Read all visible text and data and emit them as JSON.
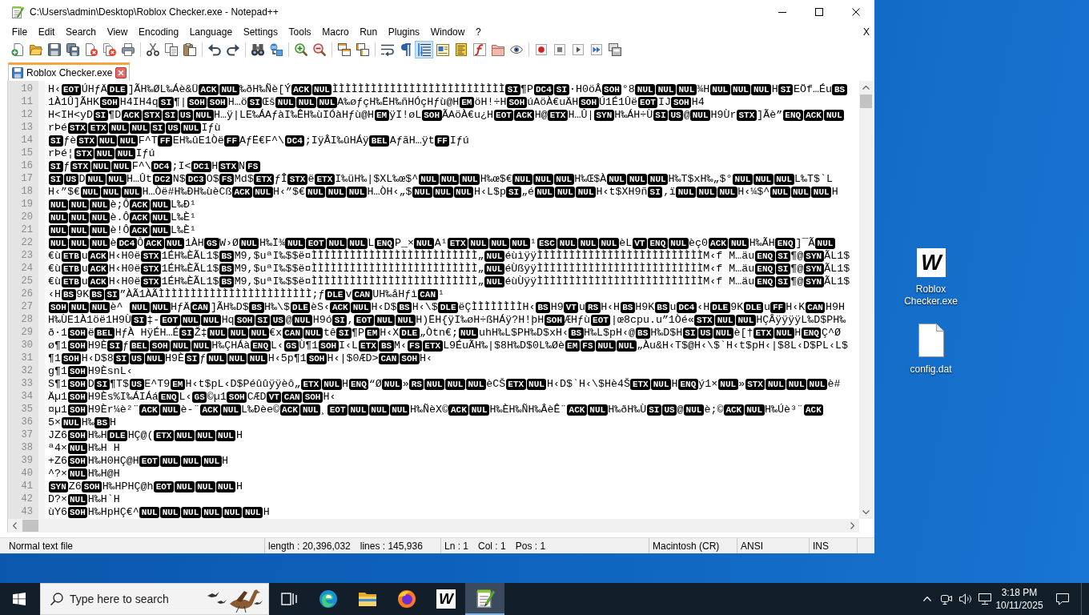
{
  "window": {
    "title": "C:\\Users\\admin\\Desktop\\Roblox Checker.exe - Notepad++"
  },
  "menu": {
    "items": [
      "File",
      "Edit",
      "Search",
      "View",
      "Encoding",
      "Language",
      "Settings",
      "Tools",
      "Macro",
      "Run",
      "Plugins",
      "Window",
      "?"
    ],
    "close_label": "X"
  },
  "toolbar": {
    "groups": [
      {
        "buttons": [
          {
            "kind": "new",
            "on": false
          },
          {
            "kind": "open",
            "on": false
          },
          {
            "kind": "save",
            "on": false
          },
          {
            "kind": "save-all",
            "on": false
          },
          {
            "kind": "close",
            "on": false
          },
          {
            "kind": "close-all",
            "on": false
          },
          {
            "kind": "print",
            "on": false
          }
        ]
      },
      {
        "buttons": [
          {
            "kind": "cut",
            "on": false
          },
          {
            "kind": "copy",
            "on": false
          },
          {
            "kind": "paste",
            "on": false
          }
        ]
      },
      {
        "buttons": [
          {
            "kind": "undo",
            "on": false
          },
          {
            "kind": "redo",
            "on": false
          }
        ]
      },
      {
        "buttons": [
          {
            "kind": "find",
            "on": false
          },
          {
            "kind": "replace",
            "on": false
          }
        ]
      },
      {
        "buttons": [
          {
            "kind": "zoom-in",
            "on": false
          },
          {
            "kind": "zoom-out",
            "on": false
          }
        ]
      },
      {
        "buttons": [
          {
            "kind": "sync-vertical",
            "on": false
          },
          {
            "kind": "sync-horizontal",
            "on": false
          }
        ]
      },
      {
        "buttons": [
          {
            "kind": "word-wrap",
            "on": false
          },
          {
            "kind": "all-chars",
            "on": false
          },
          {
            "kind": "indent-guide",
            "on": true
          },
          {
            "kind": "udl",
            "on": false
          },
          {
            "kind": "document-map",
            "on": false
          },
          {
            "kind": "function-list",
            "on": false
          },
          {
            "kind": "folder-workspace",
            "on": false
          },
          {
            "kind": "monitoring",
            "on": false
          }
        ]
      },
      {
        "buttons": [
          {
            "kind": "record",
            "on": false
          },
          {
            "kind": "stop",
            "on": false
          },
          {
            "kind": "play",
            "on": false
          },
          {
            "kind": "play-multiple",
            "on": false
          },
          {
            "kind": "save-macro",
            "on": false
          }
        ]
      }
    ]
  },
  "tabs": [
    {
      "label": "Roblox Checker.exe",
      "selected": true
    }
  ],
  "editor": {
    "lines": [
      {
        "number": "10",
        "segments": [
          {
            "text": "H‹"
          },
          {
            "control": "EOT"
          },
          {
            "text": "ÚHƒÄ"
          },
          {
            "control": "DLE"
          },
          {
            "text": "]ÃH‰ØL‰Áè&Ü"
          },
          {
            "control": "ACK"
          },
          {
            "control": "NUL"
          },
          {
            "text": "‰ðH‰Ñè[Ý"
          },
          {
            "control": "ACK"
          },
          {
            "control": "NUL"
          },
          {
            "text": "ÌÌÌÌÌÌÌÌÌÌÌÌÌÌÌÌÌÌÌÌÌÌÌÌÌÌÌ"
          },
          {
            "control": "SI"
          },
          {
            "text": "¶P"
          },
          {
            "control": "DC4"
          },
          {
            "control": "SI"
          },
          {
            "text": "·H0öÂ"
          },
          {
            "control": "SOH"
          },
          {
            "text": "°8"
          },
          {
            "control": "NUL"
          },
          {
            "control": "NUL"
          },
          {
            "control": "NUL"
          },
          {
            "text": "¾H"
          },
          {
            "control": "NUL"
          },
          {
            "control": "NUL"
          },
          {
            "control": "NUL"
          },
          {
            "text": "H"
          },
          {
            "control": "SI"
          },
          {
            "text": "EÖf…Éu"
          },
          {
            "control": "BS"
          }
        ]
      },
      {
        "number": "11",
        "segments": [
          {
            "text": "1À1Û]ÃHK"
          },
          {
            "control": "SOH"
          },
          {
            "text": "H4IH4q"
          },
          {
            "control": "SI"
          },
          {
            "text": "¶|"
          },
          {
            "control": "SOH"
          },
          {
            "control": "SOH"
          },
          {
            "text": "H…ö"
          },
          {
            "control": "SI"
          },
          {
            "text": "Œš"
          },
          {
            "control": "NUL"
          },
          {
            "control": "NUL"
          },
          {
            "control": "NUL"
          },
          {
            "text": "A‰øƒçH‰ËH‰ñHÓçHƒù@H"
          },
          {
            "control": "EM"
          },
          {
            "text": "öH!÷H"
          },
          {
            "control": "SOH"
          },
          {
            "text": "úAöÀ€uÄH"
          },
          {
            "control": "SOH"
          },
          {
            "text": "Ú1É1Ûë"
          },
          {
            "control": "EOT"
          },
          {
            "text": "IJ"
          },
          {
            "control": "SOH"
          },
          {
            "text": "H4"
          }
        ]
      },
      {
        "number": "12",
        "segments": [
          {
            "text": "H<IH<yD"
          },
          {
            "control": "SI"
          },
          {
            "text": "¶D"
          },
          {
            "control": "ACK"
          },
          {
            "control": "STX"
          },
          {
            "control": "SI"
          },
          {
            "control": "US"
          },
          {
            "control": "NUL"
          },
          {
            "text": "H…ÿ|LE‰ÁAƒàI‰ÊH‰ùIÓàHƒù@H"
          },
          {
            "control": "EM"
          },
          {
            "text": "ÿI!øL"
          },
          {
            "control": "SOH"
          },
          {
            "text": "ÃAöÀ€u¿H"
          },
          {
            "control": "EOT"
          },
          {
            "control": "ACK"
          },
          {
            "text": "H@"
          },
          {
            "control": "ETX"
          },
          {
            "text": "H…Û|"
          },
          {
            "control": "SYN"
          },
          {
            "text": "H‰ÁH÷Ù"
          },
          {
            "control": "SI"
          },
          {
            "control": "US"
          },
          {
            "text": "@"
          },
          {
            "control": "NUL"
          },
          {
            "text": "H9Ùr"
          },
          {
            "control": "STX"
          },
          {
            "text": "]Ãè”"
          },
          {
            "control": "ENQ"
          },
          {
            "control": "ACK"
          },
          {
            "control": "NUL"
          }
        ]
      },
      {
        "number": "13",
        "segments": [
          {
            "text": "rÞé"
          },
          {
            "control": "STX"
          },
          {
            "control": "ETX"
          },
          {
            "control": "NUL"
          },
          {
            "control": "NUL"
          },
          {
            "control": "SI"
          },
          {
            "control": "US"
          },
          {
            "control": "NUL"
          },
          {
            "text": "Iƒù"
          }
        ]
      },
      {
        "number": "14",
        "segments": [
          {
            "control": "SI"
          },
          {
            "text": "ƒè"
          },
          {
            "control": "STX"
          },
          {
            "control": "NUL"
          },
          {
            "control": "NUL"
          },
          {
            "text": "F^T"
          },
          {
            "control": "FF"
          },
          {
            "text": "EH‰ûE1Òë"
          },
          {
            "control": "FF"
          },
          {
            "text": "AƒË€F^\\"
          },
          {
            "control": "DC4"
          },
          {
            "text": ";IÿÂI‰ûHÁÿ"
          },
          {
            "control": "BEL"
          },
          {
            "text": "AƒãH…ÿt"
          },
          {
            "control": "FF"
          },
          {
            "text": "Iƒú"
          }
        ]
      },
      {
        "number": "15",
        "segments": [
          {
            "text": "rÞé¦"
          },
          {
            "control": "STX"
          },
          {
            "control": "NUL"
          },
          {
            "control": "NUL"
          },
          {
            "text": "Iƒú"
          }
        ]
      },
      {
        "number": "16",
        "segments": [
          {
            "control": "SI"
          },
          {
            "text": "ƒ"
          },
          {
            "control": "STX"
          },
          {
            "control": "NUL"
          },
          {
            "control": "NUL"
          },
          {
            "text": "F^\\"
          },
          {
            "control": "DC4"
          },
          {
            "text": ";I<"
          },
          {
            "control": "DC1"
          },
          {
            "text": "H"
          },
          {
            "control": "STX"
          },
          {
            "text": "N"
          },
          {
            "control": "FS"
          }
        ]
      },
      {
        "number": "17",
        "segments": [
          {
            "control": "SI"
          },
          {
            "control": "US"
          },
          {
            "text": "D"
          },
          {
            "control": "NUL"
          },
          {
            "control": "NUL"
          },
          {
            "text": "H…Ût"
          },
          {
            "control": "DC2"
          },
          {
            "text": "N$"
          },
          {
            "control": "DC3"
          },
          {
            "text": "O$"
          },
          {
            "control": "FS"
          },
          {
            "text": "Md$"
          },
          {
            "control": "ETX"
          },
          {
            "text": "ƒÎ"
          },
          {
            "control": "STX"
          },
          {
            "text": "ë"
          },
          {
            "control": "ETX"
          },
          {
            "text": "I‰üH‰|$XL‰œ$^"
          },
          {
            "control": "NUL"
          },
          {
            "control": "NUL"
          },
          {
            "control": "NUL"
          },
          {
            "text": "H‰œ$€"
          },
          {
            "control": "NUL"
          },
          {
            "control": "NUL"
          },
          {
            "control": "NUL"
          },
          {
            "text": "H‰Œ$À"
          },
          {
            "control": "NUL"
          },
          {
            "control": "NUL"
          },
          {
            "control": "NUL"
          },
          {
            "text": "H‰T$xH‰„$°"
          },
          {
            "control": "NUL"
          },
          {
            "control": "NUL"
          },
          {
            "control": "NUL"
          },
          {
            "text": "L‰T$`L"
          }
        ]
      },
      {
        "number": "18",
        "segments": [
          {
            "text": "H‹”$€"
          },
          {
            "control": "NUL"
          },
          {
            "control": "NUL"
          },
          {
            "control": "NUL"
          },
          {
            "text": "H…Òë#H‰ÐH‰ùèCß"
          },
          {
            "control": "ACK"
          },
          {
            "control": "NUL"
          },
          {
            "text": "H‹”$€"
          },
          {
            "control": "NUL"
          },
          {
            "control": "NUL"
          },
          {
            "control": "NUL"
          },
          {
            "text": "H…ÒH‹„$"
          },
          {
            "control": "NUL"
          },
          {
            "control": "NUL"
          },
          {
            "control": "NUL"
          },
          {
            "text": "H‹L$p"
          },
          {
            "control": "SI"
          },
          {
            "text": "„é"
          },
          {
            "control": "NUL"
          },
          {
            "control": "NUL"
          },
          {
            "control": "NUL"
          },
          {
            "text": "H‹t$XH9ñ"
          },
          {
            "control": "SI"
          },
          {
            "text": "‚ï"
          },
          {
            "control": "NUL"
          },
          {
            "control": "NUL"
          },
          {
            "control": "NUL"
          },
          {
            "text": "H‹¼$^"
          },
          {
            "control": "NUL"
          },
          {
            "control": "NUL"
          },
          {
            "control": "NUL"
          },
          {
            "text": "H"
          }
        ]
      },
      {
        "number": "19",
        "segments": [
          {
            "control": "NUL"
          },
          {
            "control": "NUL"
          },
          {
            "control": "NUL"
          },
          {
            "text": "è;Ô"
          },
          {
            "control": "ACK"
          },
          {
            "control": "NUL"
          },
          {
            "text": "L‰Ð¹"
          }
        ]
      },
      {
        "number": "20",
        "segments": [
          {
            "control": "NUL"
          },
          {
            "control": "NUL"
          },
          {
            "control": "NUL"
          },
          {
            "text": "è.Ô"
          },
          {
            "control": "ACK"
          },
          {
            "control": "NUL"
          },
          {
            "text": "L‰È¹"
          }
        ]
      },
      {
        "number": "21",
        "segments": [
          {
            "control": "NUL"
          },
          {
            "control": "NUL"
          },
          {
            "control": "NUL"
          },
          {
            "text": "è!Ô"
          },
          {
            "control": "ACK"
          },
          {
            "control": "NUL"
          },
          {
            "text": "L‰È¹"
          }
        ]
      },
      {
        "number": "22",
        "segments": [
          {
            "control": "NUL"
          },
          {
            "control": "NUL"
          },
          {
            "control": "NUL"
          },
          {
            "text": "è"
          },
          {
            "control": "DC4"
          },
          {
            "text": "Ô"
          },
          {
            "control": "ACK"
          },
          {
            "control": "NUL"
          },
          {
            "text": "1ÀH"
          },
          {
            "control": "GS"
          },
          {
            "text": "W›Ø"
          },
          {
            "control": "NUL"
          },
          {
            "text": "H‰Ï¾"
          },
          {
            "control": "NUL"
          },
          {
            "control": "EOT"
          },
          {
            "control": "NUL"
          },
          {
            "control": "NUL"
          },
          {
            "text": "L"
          },
          {
            "control": "ENQ"
          },
          {
            "text": "P_×"
          },
          {
            "control": "NUL"
          },
          {
            "text": "A¹"
          },
          {
            "control": "ETX"
          },
          {
            "control": "NUL"
          },
          {
            "control": "NUL"
          },
          {
            "control": "NUL"
          },
          {
            "text": "¹"
          },
          {
            "control": "ESC"
          },
          {
            "control": "NUL"
          },
          {
            "control": "NUL"
          },
          {
            "control": "NUL"
          },
          {
            "text": "èL"
          },
          {
            "control": "VT"
          },
          {
            "control": "ENQ"
          },
          {
            "control": "NUL"
          },
          {
            "text": "èç0"
          },
          {
            "control": "ACK"
          },
          {
            "control": "NUL"
          },
          {
            "text": "H‰ÃH"
          },
          {
            "control": "ENQ"
          },
          {
            "text": "]¯Ã"
          },
          {
            "control": "NUL"
          }
        ]
      },
      {
        "number": "23",
        "segments": [
          {
            "text": "€ù"
          },
          {
            "control": "ETB"
          },
          {
            "text": "u"
          },
          {
            "control": "ACK"
          },
          {
            "text": "H‹H0ë"
          },
          {
            "control": "STX"
          },
          {
            "text": "1ÉH‰ÈÃL1$"
          },
          {
            "control": "BS"
          },
          {
            "text": "M9,$uªI‰$$ë¤ÌÌÌÌÌÌÌÌÌÌÌÌÌÌÌÌÌÌÌÌÌÌÌÌÌÌ„"
          },
          {
            "control": "NUL"
          },
          {
            "text": "éùìÿÿÌÌÌÌÌÌÌÌÌÌÌÌÌÌÌÌÌÌÌÌÌÌÌÌÌÌM‹f M…äu"
          },
          {
            "control": "ENQ"
          },
          {
            "control": "SI"
          },
          {
            "text": "¶@"
          },
          {
            "control": "SYN"
          },
          {
            "text": "ÃL1$"
          }
        ]
      },
      {
        "number": "24",
        "segments": [
          {
            "text": "€ù"
          },
          {
            "control": "ETB"
          },
          {
            "text": "u"
          },
          {
            "control": "ACK"
          },
          {
            "text": "H‹H0ë"
          },
          {
            "control": "STX"
          },
          {
            "text": "1ÉH‰ÈÃL1$"
          },
          {
            "control": "BS"
          },
          {
            "text": "M9,$uªI‰$$ë¤ÌÌÌÌÌÌÌÌÌÌÌÌÌÌÌÌÌÌÌÌÌÌÌÌÌÌ„"
          },
          {
            "control": "NUL"
          },
          {
            "text": "éÙßÿÿÌÌÌÌÌÌÌÌÌÌÌÌÌÌÌÌÌÌÌÌÌÌÌÌÌÌM‹f M…äu"
          },
          {
            "control": "ENQ"
          },
          {
            "control": "SI"
          },
          {
            "text": "¶@"
          },
          {
            "control": "SYN"
          },
          {
            "text": "ÃL1$"
          }
        ]
      },
      {
        "number": "25",
        "segments": [
          {
            "text": "€ù"
          },
          {
            "control": "ETB"
          },
          {
            "text": "u"
          },
          {
            "control": "ACK"
          },
          {
            "text": "H‹H0ë"
          },
          {
            "control": "STX"
          },
          {
            "text": "1ÉH‰ÈÃL1$"
          },
          {
            "control": "BS"
          },
          {
            "text": "M9,$uªI‰$$ë¤ÌÌÌÌÌÌÌÌÌÌÌÌÌÌÌÌÌÌÌÌÌÌÌÌÌÌ„"
          },
          {
            "control": "NUL"
          },
          {
            "text": "éùÙÿÿÌÌÌÌÌÌÌÌÌÌÌÌÌÌÌÌÌÌÌÌÌÌÌÌÌÌM‹f M…äu"
          },
          {
            "control": "ENQ"
          },
          {
            "control": "SI"
          },
          {
            "text": "¶@"
          },
          {
            "control": "SYN"
          },
          {
            "text": "ÃL1$"
          }
        ]
      },
      {
        "number": "26",
        "segments": [
          {
            "text": "‹H"
          },
          {
            "control": "BS"
          },
          {
            "text": "9K"
          },
          {
            "control": "BS"
          },
          {
            "control": "SI"
          },
          {
            "text": "”ÀÃ1ÀÃÌÌÌÌÌÌÌÌÌÌÌÌÌÌÌÌÌÌÌÌÌÌÌÌ;ƒ"
          },
          {
            "control": "DLE"
          },
          {
            "text": "v"
          },
          {
            "control": "CAN"
          },
          {
            "text": "UH‰åHƒì"
          },
          {
            "control": "CAN"
          },
          {
            "text": "¹"
          }
        ]
      },
      {
        "number": "27",
        "segments": [
          {
            "control": "SOH"
          },
          {
            "control": "NUL"
          },
          {
            "control": "NUL"
          },
          {
            "text": "è^ "
          },
          {
            "control": "NUL"
          },
          {
            "control": "NUL"
          },
          {
            "text": "HƒÄ"
          },
          {
            "control": "CAN"
          },
          {
            "text": "]ÃH‰D$"
          },
          {
            "control": "BS"
          },
          {
            "text": "H‰\\$"
          },
          {
            "control": "DLE"
          },
          {
            "text": "èS‹"
          },
          {
            "control": "ACK"
          },
          {
            "control": "NUL"
          },
          {
            "text": "H‹D$"
          },
          {
            "control": "BS"
          },
          {
            "text": "H‹\\$"
          },
          {
            "control": "DLE"
          },
          {
            "text": "ëÇÌÌÌÌÌÌÌÌH‹"
          },
          {
            "control": "BS"
          },
          {
            "text": "H9"
          },
          {
            "control": "VT"
          },
          {
            "text": "u"
          },
          {
            "control": "RS"
          },
          {
            "text": "H‹H"
          },
          {
            "control": "BS"
          },
          {
            "text": "H9K"
          },
          {
            "control": "BS"
          },
          {
            "text": "u"
          },
          {
            "control": "DC4"
          },
          {
            "text": "‹H"
          },
          {
            "control": "DLE"
          },
          {
            "text": "9K"
          },
          {
            "control": "DLE"
          },
          {
            "text": "u"
          },
          {
            "control": "FF"
          },
          {
            "text": "H‹K"
          },
          {
            "control": "CAN"
          },
          {
            "text": "H9H"
          }
        ]
      },
      {
        "number": "28",
        "segments": [
          {
            "text": "H‰ÙE1À1öë1H9Ù"
          },
          {
            "control": "SI"
          },
          {
            "text": "‡-"
          },
          {
            "control": "EOT"
          },
          {
            "control": "NUL"
          },
          {
            "control": "NUL"
          },
          {
            "text": "Hq"
          },
          {
            "control": "SOH"
          },
          {
            "control": "SI"
          },
          {
            "control": "US"
          },
          {
            "text": "@"
          },
          {
            "control": "NUL"
          },
          {
            "text": "H9ó"
          },
          {
            "control": "SI"
          },
          {
            "text": ","
          },
          {
            "control": "EOT"
          },
          {
            "control": "NUL"
          },
          {
            "control": "NUL"
          },
          {
            "text": "H)ËH{ÿI‰øH÷ßHÁÿ?H!þH"
          },
          {
            "control": "SOH"
          },
          {
            "text": "ÆHƒù"
          },
          {
            "control": "EOT"
          },
          {
            "text": "|œ8cpu.u”1Òé«"
          },
          {
            "control": "STX"
          },
          {
            "control": "NUL"
          },
          {
            "control": "NUL"
          },
          {
            "text": "HÇÂÿÿÿÿL‰D$PH‰"
          }
        ]
      },
      {
        "number": "29",
        "segments": [
          {
            "text": "ð·1"
          },
          {
            "control": "SOH"
          },
          {
            "text": "ë"
          },
          {
            "control": "BEL"
          },
          {
            "text": "HƒÀ HÿÉH…É"
          },
          {
            "control": "SI"
          },
          {
            "text": "Ž‡"
          },
          {
            "control": "NUL"
          },
          {
            "control": "NUL"
          },
          {
            "control": "NUL"
          },
          {
            "text": "€x"
          },
          {
            "control": "CAN"
          },
          {
            "control": "NUL"
          },
          {
            "text": "tê"
          },
          {
            "control": "SI"
          },
          {
            "text": "¶P"
          },
          {
            "control": "EM"
          },
          {
            "text": "H‹X"
          },
          {
            "control": "DLE"
          },
          {
            "text": "„Òtn€;"
          },
          {
            "control": "NUL"
          },
          {
            "text": "uhH‰L$PH‰D$xH‹"
          },
          {
            "control": "BS"
          },
          {
            "text": "H‰L$pH‹@"
          },
          {
            "control": "BS"
          },
          {
            "text": "H‰D$H"
          },
          {
            "control": "SI"
          },
          {
            "control": "US"
          },
          {
            "control": "NUL"
          },
          {
            "text": "è[†"
          },
          {
            "control": "ETX"
          },
          {
            "control": "NUL"
          },
          {
            "text": "H"
          },
          {
            "control": "ENQ"
          },
          {
            "text": "Ç^Ø"
          }
        ]
      },
      {
        "number": "30",
        "segments": [
          {
            "text": "ø¶1"
          },
          {
            "control": "SOH"
          },
          {
            "text": "H9È"
          },
          {
            "control": "SI"
          },
          {
            "text": "ƒ"
          },
          {
            "control": "BEL"
          },
          {
            "control": "SOH"
          },
          {
            "control": "NUL"
          },
          {
            "control": "NUL"
          },
          {
            "text": "H‰ÇHÁà"
          },
          {
            "control": "ENQ"
          },
          {
            "text": "L‹"
          },
          {
            "control": "GS"
          },
          {
            "text": "Ù¶1"
          },
          {
            "control": "SOH"
          },
          {
            "text": "I‹L"
          },
          {
            "control": "ETX"
          },
          {
            "control": "BS"
          },
          {
            "text": "M‹"
          },
          {
            "control": "FS"
          },
          {
            "control": "ETX"
          },
          {
            "text": "L9ÉuÃH‰|$8H‰D$0L‰Øè"
          },
          {
            "control": "EM"
          },
          {
            "control": "FS"
          },
          {
            "control": "NUL"
          },
          {
            "control": "NUL"
          },
          {
            "text": "„Àu&H‹T$@H‹\\$`H‹t$pH‹|$8L‹D$PL‹L$"
          }
        ]
      },
      {
        "number": "31",
        "segments": [
          {
            "text": "¶1"
          },
          {
            "control": "SOH"
          },
          {
            "text": "H‹D$8"
          },
          {
            "control": "SI"
          },
          {
            "control": "US"
          },
          {
            "control": "NUL"
          },
          {
            "text": "H9È"
          },
          {
            "control": "SI"
          },
          {
            "text": "ƒ"
          },
          {
            "control": "NUL"
          },
          {
            "control": "NUL"
          },
          {
            "control": "NUL"
          },
          {
            "text": "H‹5p¶1"
          },
          {
            "control": "SOH"
          },
          {
            "text": "H‹|$0ÆD>"
          },
          {
            "control": "CAN"
          },
          {
            "control": "SOH"
          },
          {
            "text": "H‹"
          }
        ]
      },
      {
        "number": "32",
        "segments": [
          {
            "text": "g¶1"
          },
          {
            "control": "SOH"
          },
          {
            "text": "H9ÈsnL‹"
          }
        ]
      },
      {
        "number": "33",
        "segments": [
          {
            "text": "S¶1"
          },
          {
            "control": "SOH"
          },
          {
            "text": "D"
          },
          {
            "control": "SI"
          },
          {
            "text": "¶T$"
          },
          {
            "control": "US"
          },
          {
            "text": "E^T9"
          },
          {
            "control": "EM"
          },
          {
            "text": "H‹t$pL‹D$Péûûÿÿèô„"
          },
          {
            "control": "ETX"
          },
          {
            "control": "NUL"
          },
          {
            "text": "H"
          },
          {
            "control": "ENQ"
          },
          {
            "text": "“Ø"
          },
          {
            "control": "NUL"
          },
          {
            "text": "»"
          },
          {
            "control": "RS"
          },
          {
            "control": "NUL"
          },
          {
            "control": "NUL"
          },
          {
            "control": "NUL"
          },
          {
            "text": "èCŠ"
          },
          {
            "control": "ETX"
          },
          {
            "control": "NUL"
          },
          {
            "text": "H‹D$`H‹\\$Hè4Š"
          },
          {
            "control": "ETX"
          },
          {
            "control": "NUL"
          },
          {
            "text": "H"
          },
          {
            "control": "ENQ"
          },
          {
            "text": "ý1×"
          },
          {
            "control": "NUL"
          },
          {
            "text": "»"
          },
          {
            "control": "STX"
          },
          {
            "control": "NUL"
          },
          {
            "control": "NUL"
          },
          {
            "control": "NUL"
          },
          {
            "text": "è#"
          }
        ]
      },
      {
        "number": "34",
        "segments": [
          {
            "text": "Äµ1"
          },
          {
            "control": "SOH"
          },
          {
            "text": "H9Ès%I‰ÁIÁá"
          },
          {
            "control": "ENQ"
          },
          {
            "text": "L‹"
          },
          {
            "control": "GS"
          },
          {
            "text": "©µ1"
          },
          {
            "control": "SOH"
          },
          {
            "text": "CÆD"
          },
          {
            "control": "VT"
          },
          {
            "control": "CAN"
          },
          {
            "control": "SOH"
          },
          {
            "text": "H‹"
          }
        ]
      },
      {
        "number": "35",
        "segments": [
          {
            "text": "¤µ1"
          },
          {
            "control": "SOH"
          },
          {
            "text": "H9Èr¼è²¨"
          },
          {
            "control": "ACK"
          },
          {
            "control": "NUL"
          },
          {
            "text": "è-¨"
          },
          {
            "control": "ACK"
          },
          {
            "control": "NUL"
          },
          {
            "text": "L‰Ðèe©"
          },
          {
            "control": "ACK"
          },
          {
            "control": "NUL"
          },
          {
            "text": "¸"
          },
          {
            "control": "EOT"
          },
          {
            "control": "NUL"
          },
          {
            "control": "NUL"
          },
          {
            "control": "NUL"
          },
          {
            "text": "H‰ÑèX©"
          },
          {
            "control": "ACK"
          },
          {
            "control": "NUL"
          },
          {
            "text": "H‰ÈH‰ÑH‰ÂèÊ¨"
          },
          {
            "control": "ACK"
          },
          {
            "control": "NUL"
          },
          {
            "text": "H‰ðH‰Ù"
          },
          {
            "control": "SI"
          },
          {
            "control": "US"
          },
          {
            "text": "@"
          },
          {
            "control": "NUL"
          },
          {
            "text": "è;©"
          },
          {
            "control": "ACK"
          },
          {
            "control": "NUL"
          },
          {
            "text": "H‰Úè³¨"
          },
          {
            "control": "ACK"
          }
        ]
      },
      {
        "number": "36",
        "segments": [
          {
            "text": "5×"
          },
          {
            "control": "NUL"
          },
          {
            "text": "H‰"
          },
          {
            "control": "BS"
          },
          {
            "text": "H"
          }
        ]
      },
      {
        "number": "37",
        "segments": [
          {
            "text": "JZ6"
          },
          {
            "control": "SOH"
          },
          {
            "text": "H‰H"
          },
          {
            "control": "DLE"
          },
          {
            "text": "HÇ@("
          },
          {
            "control": "ETX"
          },
          {
            "control": "NUL"
          },
          {
            "control": "NUL"
          },
          {
            "control": "NUL"
          },
          {
            "text": "H"
          }
        ]
      },
      {
        "number": "38",
        "segments": [
          {
            "text": "ª4×"
          },
          {
            "control": "NUL"
          },
          {
            "text": "H‰H H"
          }
        ]
      },
      {
        "number": "39",
        "segments": [
          {
            "text": "+Z6"
          },
          {
            "control": "SOH"
          },
          {
            "text": "H‰H0HÇ@H"
          },
          {
            "control": "EOT"
          },
          {
            "control": "NUL"
          },
          {
            "control": "NUL"
          },
          {
            "control": "NUL"
          },
          {
            "text": "H"
          }
        ]
      },
      {
        "number": "40",
        "segments": [
          {
            "text": "^?×"
          },
          {
            "control": "NUL"
          },
          {
            "text": "H‰H@H"
          }
        ]
      },
      {
        "number": "41",
        "segments": [
          {
            "control": "SYN"
          },
          {
            "text": "Z6"
          },
          {
            "control": "SOH"
          },
          {
            "text": "H‰HPHÇ@h"
          },
          {
            "control": "EOT"
          },
          {
            "control": "NUL"
          },
          {
            "control": "NUL"
          },
          {
            "control": "NUL"
          },
          {
            "text": "H"
          }
        ]
      },
      {
        "number": "42",
        "segments": [
          {
            "text": "D?×"
          },
          {
            "control": "NUL"
          },
          {
            "text": "H‰H`H"
          }
        ]
      },
      {
        "number": "43",
        "segments": [
          {
            "text": "ùY6"
          },
          {
            "control": "SOH"
          },
          {
            "text": "H‰HpHÇ€^"
          },
          {
            "control": "NUL"
          },
          {
            "control": "NUL"
          },
          {
            "control": "NUL"
          },
          {
            "control": "NUL"
          },
          {
            "control": "NUL"
          },
          {
            "control": "NUL"
          },
          {
            "text": "H"
          }
        ]
      }
    ]
  },
  "status_bar": {
    "file_type": "Normal text file",
    "length": "length : 20,396,032",
    "lines": "lines : 145,936",
    "line": "Ln : 1",
    "column": "Col : 1",
    "position": "Pos : 1",
    "eol": "Macintosh (CR)",
    "encoding": "ANSI",
    "mode": "INS"
  },
  "desktop_icons": [
    {
      "kind": "app",
      "logo_letter": "W",
      "label": "Roblox Checker.exe"
    },
    {
      "kind": "file",
      "label": "config.dat"
    }
  ],
  "taskbar": {
    "search": {
      "placeholder": "Type here to search"
    },
    "apps": [
      {
        "kind": "task-view",
        "selected": false
      },
      {
        "kind": "edge",
        "selected": false
      },
      {
        "kind": "explorer",
        "selected": false
      },
      {
        "kind": "firefox",
        "selected": false
      },
      {
        "kind": "letter-app",
        "logo_letter": "W",
        "selected": false
      },
      {
        "kind": "notepad",
        "selected": true
      }
    ],
    "clock": {
      "time": "3:18 PM",
      "date": "10/11/2025"
    }
  }
}
